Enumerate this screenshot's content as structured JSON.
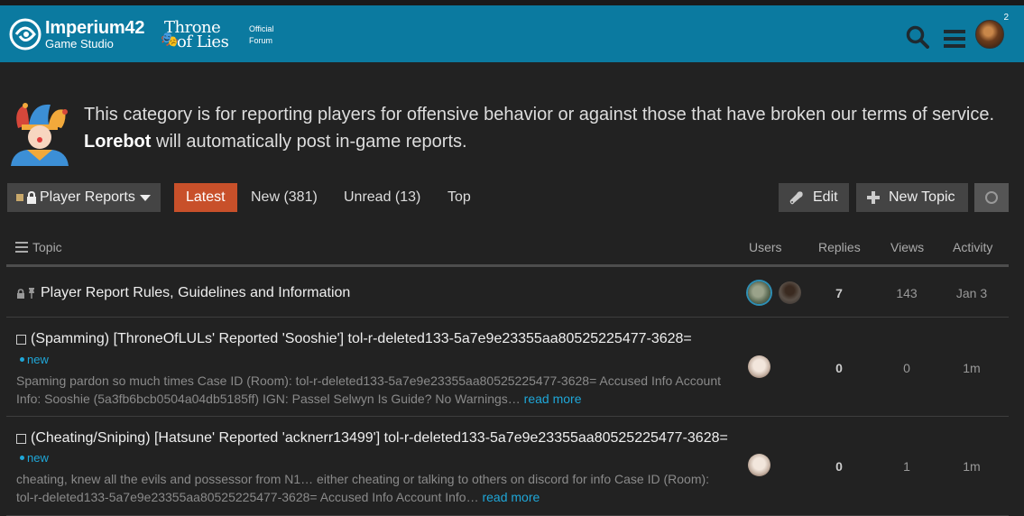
{
  "header": {
    "brand_line1": "Imperium42",
    "brand_line2": "Game Studio",
    "tol_line1": "Throne",
    "tol_line2": "of Lies",
    "official_line1": "Official",
    "official_line2": "Forum",
    "notification_count": "2",
    "bg_color": "#0b7aa0"
  },
  "banner": {
    "text_before": "This category is for reporting players for offensive behavior or against those that have broken our terms of service. ",
    "bold": "Lorebot",
    "text_after": " will automatically post in-game reports."
  },
  "nav": {
    "category": "Player Reports",
    "tabs": [
      "Latest",
      "New (381)",
      "Unread (13)",
      "Top"
    ],
    "edit_label": "Edit",
    "new_topic_label": "New Topic",
    "active_color": "#c8502a"
  },
  "table": {
    "headers": {
      "topic": "Topic",
      "users": "Users",
      "replies": "Replies",
      "views": "Views",
      "activity": "Activity"
    },
    "rows": [
      {
        "title": "Player Report Rules, Guidelines and Information",
        "replies": "7",
        "views": "143",
        "activity": "Jan 3"
      },
      {
        "title": "(Spamming) [ThroneOfLULs' Reported 'Sooshie'] tol-r-deleted133-5a7e9e23355aa80525225477-3628=",
        "badge": "new",
        "excerpt": "Spaming pardon so much times Case ID (Room): tol-r-deleted133-5a7e9e23355aa80525225477-3628= Accused Info Account Info: Sooshie (5a3fb6bcb0504a04db5185ff) IGN: Passel Selwyn Is Guide? No Warnings…",
        "read_more": "read more",
        "replies": "0",
        "views": "0",
        "activity": "1m"
      },
      {
        "title": "(Cheating/Sniping) [Hatsune' Reported 'acknerr13499'] tol-r-deleted133-5a7e9e23355aa80525225477-3628=",
        "badge": "new",
        "excerpt": "cheating, knew all the evils and possessor from N1… either cheating or talking to others on discord for info Case ID (Room): tol-r-deleted133-5a7e9e23355aa80525225477-3628= Accused Info Account Info…",
        "read_more": "read more",
        "replies": "0",
        "views": "1",
        "activity": "1m"
      }
    ]
  }
}
